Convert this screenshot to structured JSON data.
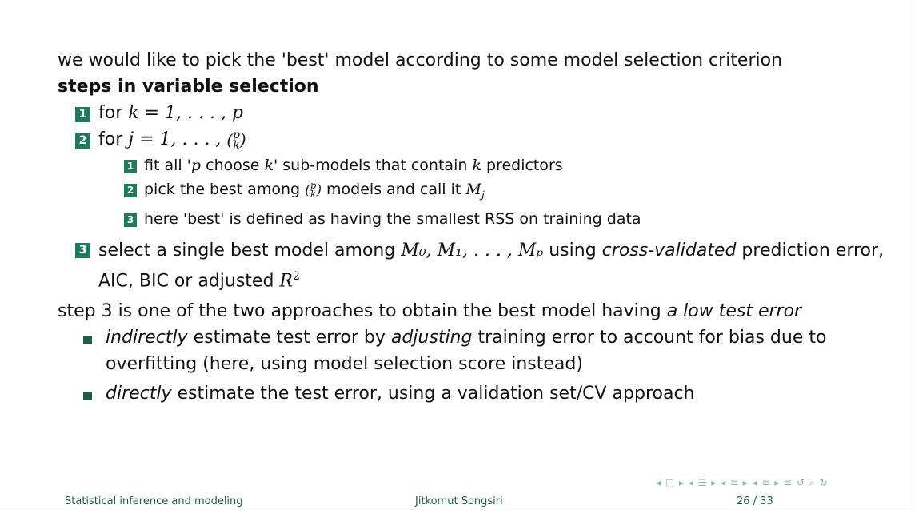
{
  "intro": "we would like to pick the 'best' model according to some model selection criterion",
  "heading": "steps in variable selection",
  "steps": {
    "s1": {
      "num": "1",
      "text": "for ",
      "math": "k = 1, . . . , p"
    },
    "s2": {
      "num": "2",
      "text": "for ",
      "math": "j = 1, . . . , ",
      "binom_top": "p",
      "binom_bottom": "k"
    },
    "sub": [
      {
        "num": "1",
        "text_a": "fit all '",
        "math_a": "p",
        "text_b": " choose ",
        "math_b": "k",
        "text_c": "' sub-models that contain ",
        "math_c": "k",
        "text_d": " predictors"
      },
      {
        "num": "2",
        "text_a": "pick the best among ",
        "binom_top": "p",
        "binom_bottom": "k",
        "text_b": " models and call it ",
        "math_b": "M",
        "math_sub": "j"
      },
      {
        "num": "3",
        "text": "here 'best' is defined as having the smallest RSS on training data"
      }
    ],
    "s3": {
      "num": "3",
      "text_a": "select a single best model among ",
      "math": "M₀, M₁, . . . , Mₚ",
      "text_b": " using ",
      "em": "cross-validated",
      "text_c": " prediction error, AIC, BIC or adjusted ",
      "math_r": "R",
      "sup": "2"
    }
  },
  "step3_note": {
    "text": "step 3 is one of the two approaches to obtain the best model having ",
    "em": "a low test error"
  },
  "bullets": [
    {
      "em_a": "indirectly",
      "text_a": " estimate test error by ",
      "em_b": "adjusting",
      "text_b": " training error to account for bias due to overfitting (here, using model selection score instead)"
    },
    {
      "em_a": "directly",
      "text_a": " estimate the test error, using a validation set/CV approach"
    }
  ],
  "footer": {
    "course": "Statistical inference and modeling",
    "author": "Jitkomut Songsiri",
    "page": "26 / 33"
  },
  "nav_icons": "◂ □ ▸  ◂ ☰ ▸  ◂ ≡ ▸  ◂ ≡ ▸   ≡   ↺ ⌕ ↻",
  "colors": {
    "accent": "#1f7a5b",
    "footer_text": "#1f5c4a"
  }
}
